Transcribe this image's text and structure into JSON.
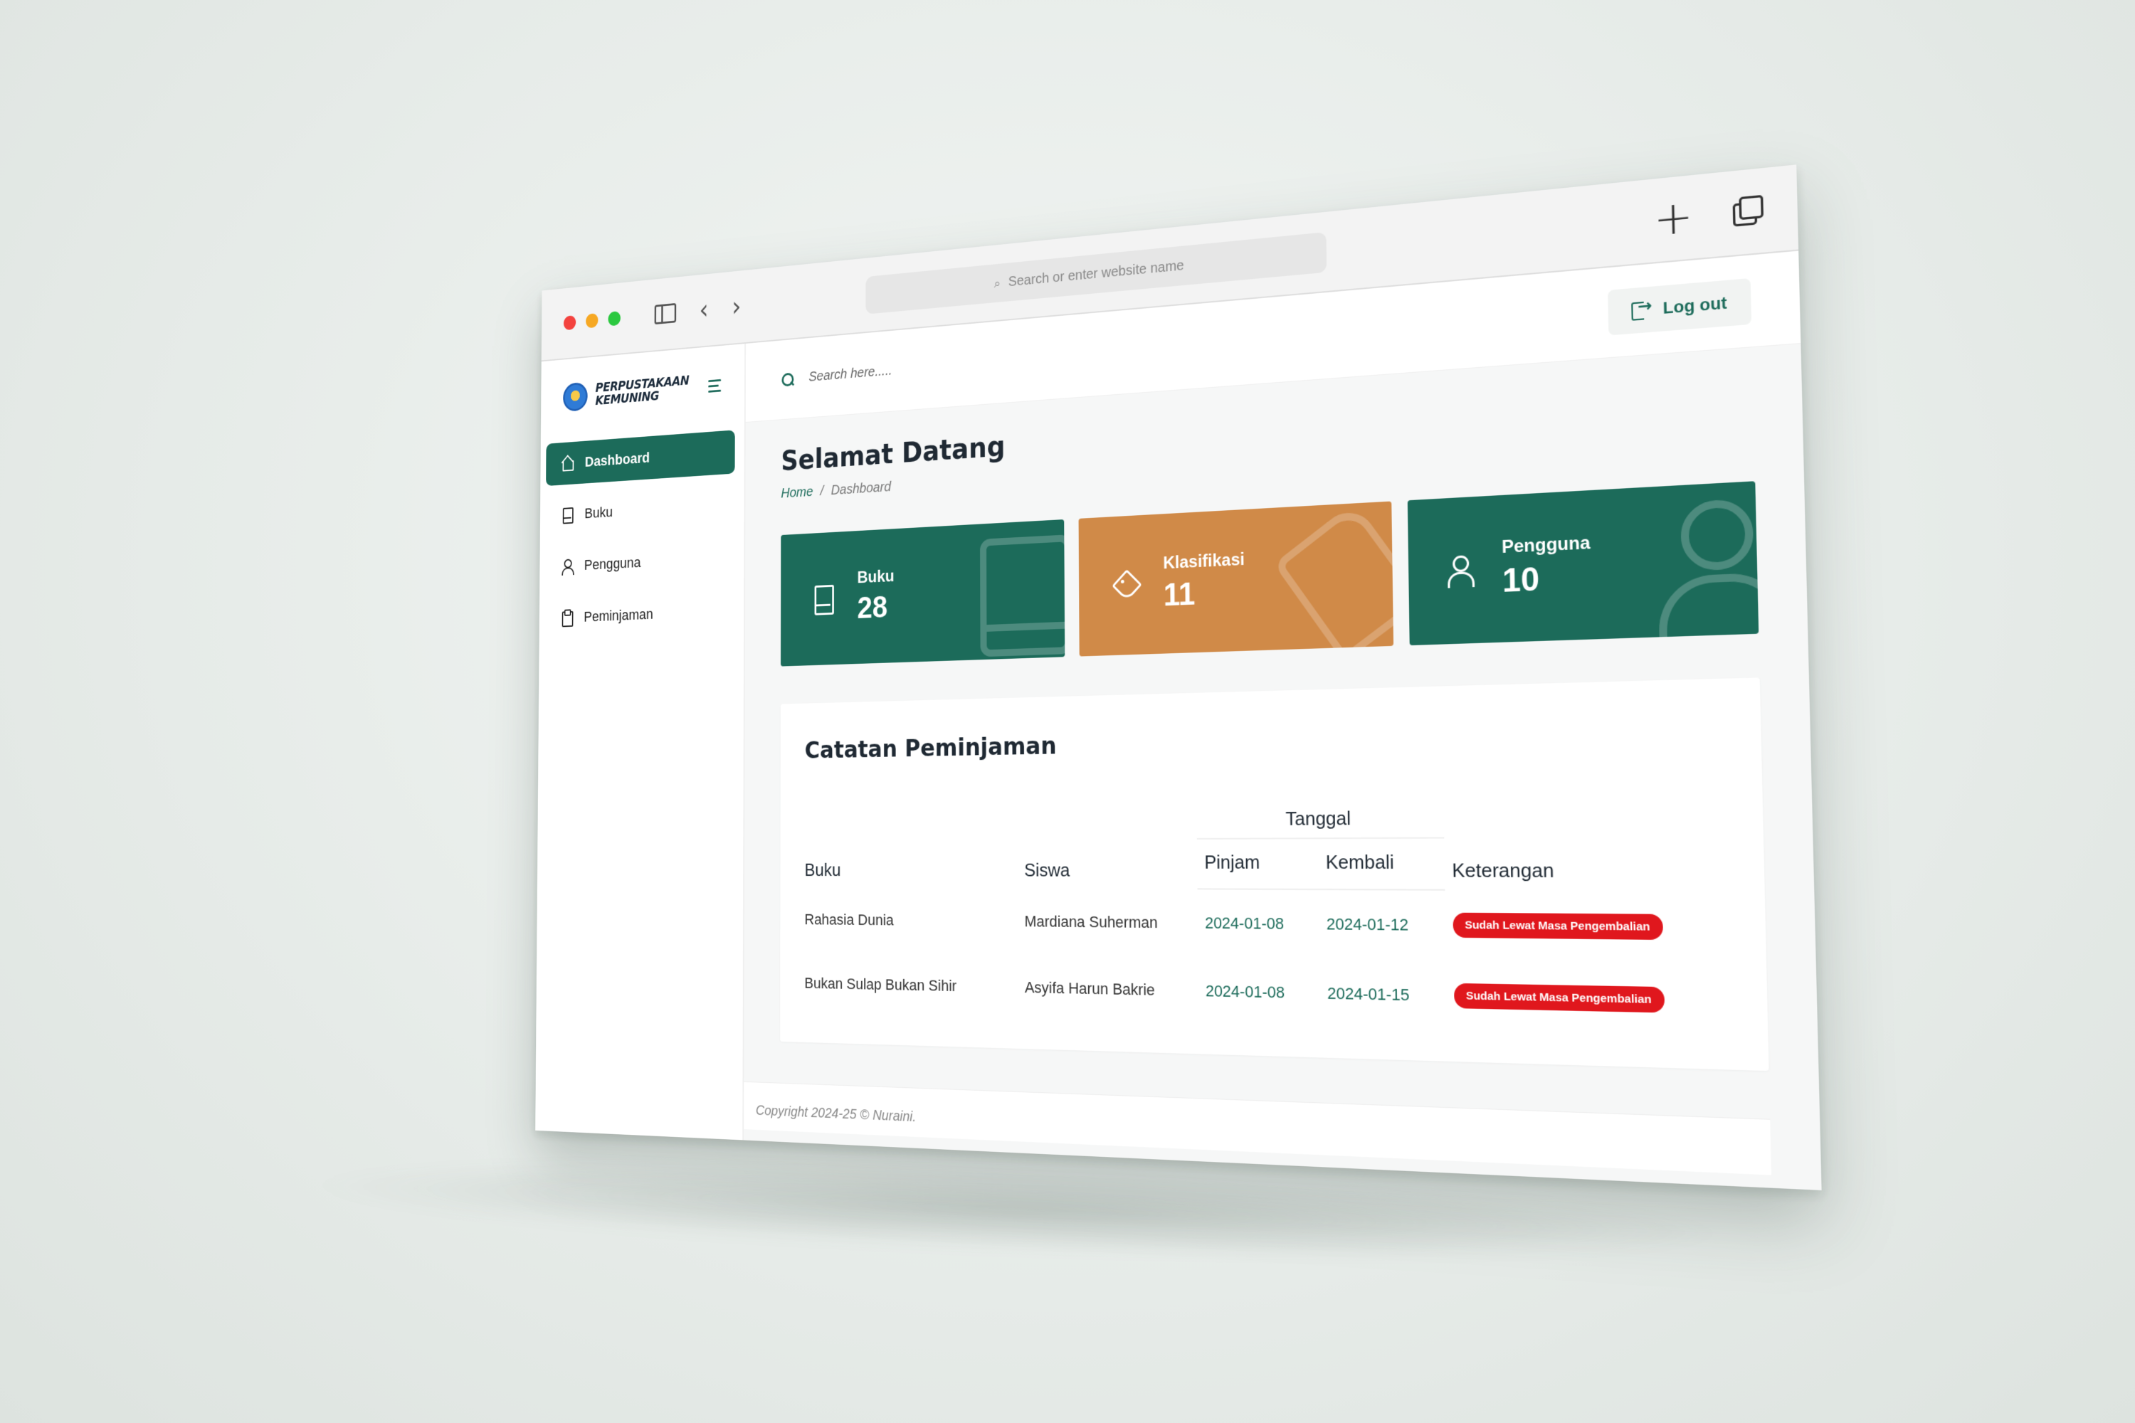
{
  "browser": {
    "address_placeholder": "Search or enter website name"
  },
  "brand": {
    "name": "PERPUSTAKAAN KEMUNING"
  },
  "sidebar": {
    "items": [
      {
        "label": "Dashboard",
        "icon": "home-icon",
        "active": true
      },
      {
        "label": "Buku",
        "icon": "book-icon",
        "active": false
      },
      {
        "label": "Pengguna",
        "icon": "user-icon",
        "active": false
      },
      {
        "label": "Peminjaman",
        "icon": "clipboard-icon",
        "active": false
      }
    ]
  },
  "topbar": {
    "search_placeholder": "Search here.....",
    "logout_label": "Log out"
  },
  "page": {
    "title": "Selamat Datang",
    "breadcrumb": {
      "home": "Home",
      "separator": "/",
      "current": "Dashboard"
    }
  },
  "stats": [
    {
      "label": "Buku",
      "value": "28",
      "color": "#1c6b5a",
      "icon": "book-icon"
    },
    {
      "label": "Klasifikasi",
      "value": "11",
      "color": "#d08a48",
      "icon": "tag-icon"
    },
    {
      "label": "Pengguna",
      "value": "10",
      "color": "#1c6b5a",
      "icon": "user-icon"
    }
  ],
  "loans": {
    "title": "Catatan Peminjaman",
    "headers": {
      "buku": "Buku",
      "siswa": "Siswa",
      "tanggal": "Tanggal",
      "pinjam": "Pinjam",
      "kembali": "Kembali",
      "keterangan": "Keterangan"
    },
    "rows": [
      {
        "buku": "Rahasia Dunia",
        "siswa": "Mardiana Suherman",
        "pinjam": "2024-01-08",
        "kembali": "2024-01-12",
        "keterangan": "Sudah Lewat Masa Pengembalian"
      },
      {
        "buku": "Bukan Sulap Bukan Sihir",
        "siswa": "Asyifa Harun Bakrie",
        "pinjam": "2024-01-08",
        "kembali": "2024-01-15",
        "keterangan": "Sudah Lewat Masa Pengembalian"
      }
    ]
  },
  "footer": {
    "copyright": "Copyright 2024-25 © Nuraini."
  },
  "colors": {
    "primary": "#1c6b5a",
    "accent": "#d08a48",
    "danger": "#e0171d"
  }
}
